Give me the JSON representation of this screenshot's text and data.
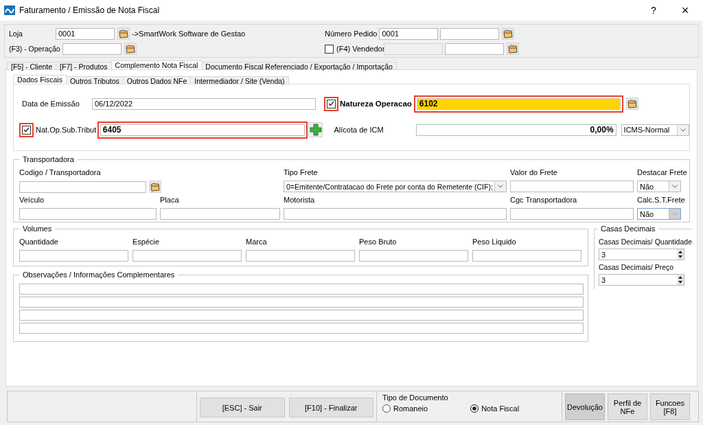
{
  "window": {
    "title": "Faturamento / Emissão de Nota Fiscal",
    "help": "?",
    "close": "×"
  },
  "header": {
    "loja": {
      "label": "Loja",
      "value": "0001",
      "description": "->SmartWork Software de Gestao"
    },
    "operacao": {
      "label": "(F3) - Operação"
    },
    "numero_pedido": {
      "label": "Número Pedido",
      "value": "0001"
    },
    "vendedor": {
      "label": "(F4) Vendedor",
      "checked": false
    }
  },
  "tabs": [
    {
      "label": "[F5] - Cliente",
      "selected": false
    },
    {
      "label": "[F7] - Produtos",
      "selected": false
    },
    {
      "label": "Complemento Nota Fiscal",
      "selected": true
    },
    {
      "label": "Documento Fiscal Referenciado / Exportação / Importação",
      "selected": false
    }
  ],
  "subtabs": [
    {
      "label": "Dados Fiscais",
      "selected": true
    },
    {
      "label": "Outros Tributos",
      "selected": false
    },
    {
      "label": "Outros Dados NFe",
      "selected": false
    },
    {
      "label": "Intermediador / Site (Venda)",
      "selected": false
    }
  ],
  "dados_fiscais": {
    "data_emissao": {
      "label": "Data de Emissão",
      "value": "06/12/2022"
    },
    "natureza": {
      "label": "Natureza Operacao",
      "checked": true,
      "value": "6102",
      "highlighted": true
    },
    "nat_sub": {
      "label": "Nat.Op.Sub.Tribut",
      "checked": true,
      "value": "6405",
      "highlighted": true
    },
    "aliquota": {
      "label": "Alícota de ICM",
      "value": "0,00%",
      "type": "ICMS-Normal"
    }
  },
  "transportadora": {
    "title": "Transportadora",
    "fields": [
      {
        "label": "Codigo / Transportadora",
        "kind": "lookup"
      },
      {
        "label": "Tipo Frete",
        "kind": "select",
        "value": "0=Emitente/Contratacao do Frete por conta do Remetente (CIF);",
        "disabled": false
      },
      {
        "label": "Valor do Frete",
        "kind": "text"
      },
      {
        "label": "Destacar Frete",
        "kind": "select",
        "value": "Não",
        "disabled": false
      },
      {
        "label": "Veículo",
        "kind": "text"
      },
      {
        "label": "Placa",
        "kind": "text"
      },
      {
        "label": "Motorista",
        "kind": "text"
      },
      {
        "label": "Cgc Transportadora",
        "kind": "text"
      },
      {
        "label": "Calc.S.T.Frete",
        "kind": "select",
        "value": "Não",
        "disabled": true
      }
    ]
  },
  "volumes": {
    "title": "Volumes",
    "fields": [
      {
        "label": "Quantidade"
      },
      {
        "label": "Espécie"
      },
      {
        "label": "Marca"
      },
      {
        "label": "Peso Bruto"
      },
      {
        "label": "Peso Liquido"
      }
    ]
  },
  "casas_decimais": {
    "title": "Casas Decimais",
    "spinners": [
      {
        "label": "Casas Decimais/ Quantidade",
        "value": "3"
      },
      {
        "label": "Casas Decimais/ Preço",
        "value": "3"
      }
    ]
  },
  "observacoes": {
    "title": "Observações / Informações Complementares"
  },
  "footer": {
    "buttons": [
      {
        "label": "[ESC]  -  Sair"
      },
      {
        "label": "[F10]  -  Finalizar"
      }
    ],
    "tipo_documento": {
      "title": "Tipo de Documento",
      "options": [
        {
          "label": "Romaneio",
          "selected": false
        },
        {
          "label": "Nota Fiscal",
          "selected": true
        }
      ]
    },
    "side_buttons": [
      {
        "label": "Devolução",
        "pressed": true
      },
      {
        "label": "Perfil de NFe",
        "pressed": false
      },
      {
        "label": "Funcoes [F8]",
        "pressed": false
      }
    ]
  }
}
